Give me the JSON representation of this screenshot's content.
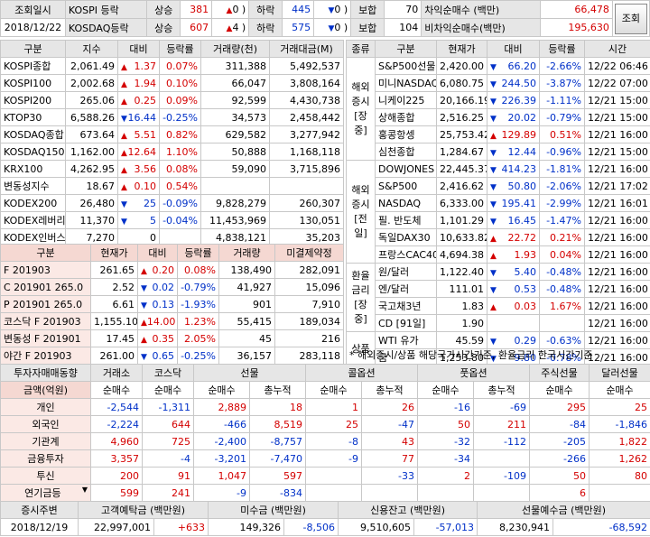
{
  "header": {
    "row1": {
      "label": "조회일시",
      "market": "KOSPI 등락",
      "up_label": "상승",
      "up_count": "381",
      "up_limit": "0",
      "down_label": "하락",
      "down_count": "445",
      "down_limit": "0",
      "flat_label": "보합",
      "flat_count": "70",
      "arb_label": "차익순매수 (백만)",
      "arb_value": "66,478"
    },
    "row2": {
      "date": "2018/12/22",
      "market": "KOSDAQ등락",
      "up_label": "상승",
      "up_count": "607",
      "up_limit": "4",
      "down_label": "하락",
      "down_count": "575",
      "down_limit": "0",
      "flat_label": "보합",
      "flat_count": "104",
      "arb_label": "비차익순매수(백만)",
      "arb_value": "195,630"
    },
    "query_button": "조회"
  },
  "index_table": {
    "headers": [
      "구분",
      "지수",
      "대비",
      "등락률",
      "거래량(천)",
      "거래대금(M)"
    ],
    "rows": [
      {
        "name": "KOSPI종합",
        "value": "2,061.49",
        "dir": "up",
        "chg": "1.37",
        "rate": "0.07%",
        "vol": "311,388",
        "amt": "5,492,537"
      },
      {
        "name": "KOSPI100",
        "value": "2,002.68",
        "dir": "up",
        "chg": "1.94",
        "rate": "0.10%",
        "vol": "66,047",
        "amt": "3,808,164"
      },
      {
        "name": "KOSPI200",
        "value": "265.06",
        "dir": "up",
        "chg": "0.25",
        "rate": "0.09%",
        "vol": "92,599",
        "amt": "4,430,738"
      },
      {
        "name": "KTOP30",
        "value": "6,588.26",
        "dir": "dn",
        "chg": "16.44",
        "rate": "-0.25%",
        "vol": "34,573",
        "amt": "2,458,442"
      },
      {
        "name": "KOSDAQ종합",
        "value": "673.64",
        "dir": "up",
        "chg": "5.51",
        "rate": "0.82%",
        "vol": "629,582",
        "amt": "3,277,942"
      },
      {
        "name": "KOSDAQ150",
        "value": "1,162.00",
        "dir": "up",
        "chg": "12.64",
        "rate": "1.10%",
        "vol": "50,888",
        "amt": "1,168,118"
      },
      {
        "name": "KRX100",
        "value": "4,262.95",
        "dir": "up",
        "chg": "3.56",
        "rate": "0.08%",
        "vol": "59,090",
        "amt": "3,715,896"
      },
      {
        "name": "변동성지수",
        "value": "18.67",
        "dir": "up",
        "chg": "0.10",
        "rate": "0.54%",
        "vol": "",
        "amt": ""
      },
      {
        "name": "KODEX200",
        "value": "26,480",
        "dir": "dn",
        "chg": "25",
        "rate": "-0.09%",
        "vol": "9,828,279",
        "amt": "260,307"
      },
      {
        "name": "KODEX레버리지",
        "value": "11,370",
        "dir": "dn",
        "chg": "5",
        "rate": "-0.04%",
        "vol": "11,453,969",
        "amt": "130,051"
      },
      {
        "name": "KODEX인버스",
        "value": "7,270",
        "dir": "",
        "chg": "0",
        "rate": "",
        "vol": "4,838,121",
        "amt": "35,203"
      }
    ]
  },
  "deriv_table": {
    "headers": [
      "구분",
      "현재가",
      "대비",
      "등락률",
      "거래량",
      "미결제약정"
    ],
    "rows": [
      {
        "name": "F 201903",
        "value": "261.65",
        "dir": "up",
        "chg": "0.20",
        "rate": "0.08%",
        "vol": "138,490",
        "oi": "282,091"
      },
      {
        "name": "C 201901 265.0",
        "value": "2.52",
        "dir": "dn",
        "chg": "0.02",
        "rate": "-0.79%",
        "vol": "41,927",
        "oi": "15,096"
      },
      {
        "name": "P 201901 265.0",
        "value": "6.61",
        "dir": "dn",
        "chg": "0.13",
        "rate": "-1.93%",
        "vol": "901",
        "oi": "7,910"
      },
      {
        "name": "코스닥 F 201903",
        "value": "1,155.10",
        "dir": "up",
        "chg": "14.00",
        "rate": "1.23%",
        "vol": "55,415",
        "oi": "189,034"
      },
      {
        "name": "변동성 F 201901",
        "value": "17.45",
        "dir": "up",
        "chg": "0.35",
        "rate": "2.05%",
        "vol": "45",
        "oi": "216"
      },
      {
        "name": "야간 F 201903",
        "value": "261.00",
        "dir": "dn",
        "chg": "0.65",
        "rate": "-0.25%",
        "vol": "36,157",
        "oi": "283,118"
      }
    ]
  },
  "world_table": {
    "headers": [
      "종류",
      "구분",
      "현재가",
      "대비",
      "등락률",
      "시간"
    ],
    "groups": [
      {
        "label": "해외\n증시\n[장중]",
        "rows": [
          {
            "name": "S&P500선물",
            "value": "2,420.00",
            "dir": "dn",
            "chg": "66.20",
            "rate": "-2.66%",
            "time": "12/22 06:46"
          },
          {
            "name": "미니NASDAQ",
            "value": "6,080.75",
            "dir": "dn",
            "chg": "244.50",
            "rate": "-3.87%",
            "time": "12/22 07:00"
          },
          {
            "name": "니케이225",
            "value": "20,166.19",
            "dir": "dn",
            "chg": "226.39",
            "rate": "-1.11%",
            "time": "12/21 15:00"
          },
          {
            "name": "상해종합",
            "value": "2,516.25",
            "dir": "dn",
            "chg": "20.02",
            "rate": "-0.79%",
            "time": "12/21 15:00"
          },
          {
            "name": "홍콩항셍",
            "value": "25,753.42",
            "dir": "up",
            "chg": "129.89",
            "rate": "0.51%",
            "time": "12/21 16:00"
          },
          {
            "name": "심천종합",
            "value": "1,284.67",
            "dir": "dn",
            "chg": "12.44",
            "rate": "-0.96%",
            "time": "12/21 15:00"
          }
        ]
      },
      {
        "label": "해외\n증시\n[전일]",
        "rows": [
          {
            "name": "DOWJONES",
            "value": "22,445.37",
            "dir": "dn",
            "chg": "414.23",
            "rate": "-1.81%",
            "time": "12/21 16:00"
          },
          {
            "name": "S&P500",
            "value": "2,416.62",
            "dir": "dn",
            "chg": "50.80",
            "rate": "-2.06%",
            "time": "12/21 17:02"
          },
          {
            "name": "NASDAQ",
            "value": "6,333.00",
            "dir": "dn",
            "chg": "195.41",
            "rate": "-2.99%",
            "time": "12/21 16:01"
          },
          {
            "name": "필. 반도체",
            "value": "1,101.29",
            "dir": "dn",
            "chg": "16.45",
            "rate": "-1.47%",
            "time": "12/21 16:00"
          },
          {
            "name": "독일DAX30",
            "value": "10,633.82",
            "dir": "up",
            "chg": "22.72",
            "rate": "0.21%",
            "time": "12/21 16:00"
          },
          {
            "name": "프랑스CAC40",
            "value": "4,694.38",
            "dir": "up",
            "chg": "1.93",
            "rate": "0.04%",
            "time": "12/21 16:00"
          }
        ]
      },
      {
        "label": "환율\n금리\n[장중]",
        "rows": [
          {
            "name": "원/달러",
            "value": "1,122.40",
            "dir": "dn",
            "chg": "5.40",
            "rate": "-0.48%",
            "time": "12/21 16:00"
          },
          {
            "name": "엔/달러",
            "value": "111.01",
            "dir": "dn",
            "chg": "0.53",
            "rate": "-0.48%",
            "time": "12/21 16:00"
          },
          {
            "name": "국고채3년",
            "value": "1.83",
            "dir": "up",
            "chg": "0.03",
            "rate": "1.67%",
            "time": "12/21 16:00"
          },
          {
            "name": "CD [91일]",
            "value": "1.90",
            "dir": "",
            "chg": "",
            "rate": "",
            "time": "12/21 16:00"
          }
        ]
      },
      {
        "label": "상품",
        "rows": [
          {
            "name": "WTI 유가",
            "value": "45.59",
            "dir": "dn",
            "chg": "0.29",
            "rate": "-0.63%",
            "time": "12/21 16:00"
          },
          {
            "name": "금",
            "value": "1,253.80",
            "dir": "dn",
            "chg": "9.80",
            "rate": "-0.78%",
            "time": "12/21 16:00"
          }
        ]
      }
    ],
    "note": "* 해외증시/상품 해당국가시간기준, 환율금리 한국시간기준"
  },
  "investor_table": {
    "title": "투자자매매동향",
    "cols": [
      "거래소",
      "코스닥",
      "선물",
      "콜옵션",
      "풋옵션",
      "주식선물",
      "달러선물"
    ],
    "sub_unit": "금액(억원)",
    "subs": [
      "순매수",
      "순매수",
      "순매수",
      "총누적",
      "순매수",
      "총누적",
      "순매수",
      "총누적",
      "순매수",
      "순매수"
    ],
    "rows": [
      {
        "name": "개인",
        "v": [
          "-2,544",
          "-1,311",
          "2,889",
          "18",
          "1",
          "26",
          "-16",
          "-69",
          "295",
          "25"
        ]
      },
      {
        "name": "외국인",
        "v": [
          "-2,224",
          "644",
          "-466",
          "8,519",
          "25",
          "-47",
          "50",
          "211",
          "-84",
          "-1,846"
        ]
      },
      {
        "name": "기관계",
        "v": [
          "4,960",
          "725",
          "-2,400",
          "-8,757",
          "-8",
          "43",
          "-32",
          "-112",
          "-205",
          "1,822"
        ]
      },
      {
        "name": "금융투자",
        "v": [
          "3,357",
          "-4",
          "-3,201",
          "-7,470",
          "-9",
          "77",
          "-34",
          "",
          "-266",
          "1,262"
        ]
      },
      {
        "name": "투신",
        "v": [
          "200",
          "91",
          "1,047",
          "597",
          "",
          "-33",
          "2",
          "-109",
          "50",
          "80"
        ]
      },
      {
        "name": "연기금등",
        "v": [
          "599",
          "241",
          "-9",
          "-834",
          "",
          "",
          "",
          "",
          "6",
          ""
        ]
      }
    ]
  },
  "footer": {
    "headers": [
      "증시주변",
      "고객예탁금 (백만원)",
      "미수금 (백만원)",
      "신용잔고 (백만원)",
      "선물예수금 (백만원)"
    ],
    "date": "2018/12/19",
    "deposit": "22,997,001",
    "deposit_chg": "+633",
    "unpaid": "149,326",
    "unpaid_chg": "-8,506",
    "credit": "9,510,605",
    "credit_chg": "-57,013",
    "futures": "8,230,941",
    "futures_chg": "-68,592"
  }
}
